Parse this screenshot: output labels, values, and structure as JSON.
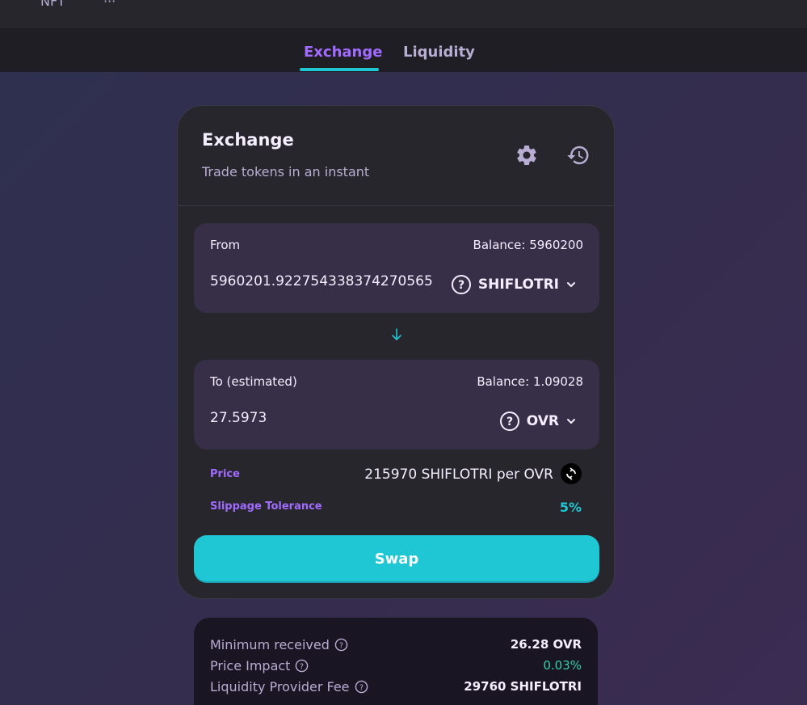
{
  "topnav": {
    "item_1": "NFT",
    "item_2": "···"
  },
  "tabs": [
    {
      "label": "Exchange",
      "active": true
    },
    {
      "label": "Liquidity",
      "active": false
    }
  ],
  "card": {
    "title": "Exchange",
    "subtitle": "Trade tokens in an instant",
    "icons": {
      "settings": "gear-icon",
      "history": "history-icon"
    }
  },
  "from": {
    "label": "From",
    "balance": "Balance: 5960200",
    "amount": "5960201.922754338374270565",
    "token": "SHIFLOTRI"
  },
  "to": {
    "label": "To (estimated)",
    "balance": "Balance: 1.09028",
    "amount": "27.5973",
    "token": "OVR"
  },
  "price": {
    "label": "Price",
    "value": "215970 SHIFLOTRI per OVR"
  },
  "slippage": {
    "label": "Slippage Tolerance",
    "value": "5%"
  },
  "swap": {
    "label": "Swap"
  },
  "details": {
    "rows": [
      {
        "label": "Minimum received",
        "value": "26.28 OVR"
      },
      {
        "label": "Price Impact",
        "value": "0.03%"
      },
      {
        "label": "Liquidity Provider Fee",
        "value": "29760 SHIFLOTRI"
      }
    ]
  },
  "colors": {
    "accent": "#1fc7d4",
    "primary_text": "#a26bff",
    "success": "#31d0aa",
    "card_bg": "#27262c",
    "input_bg": "#372f47"
  }
}
